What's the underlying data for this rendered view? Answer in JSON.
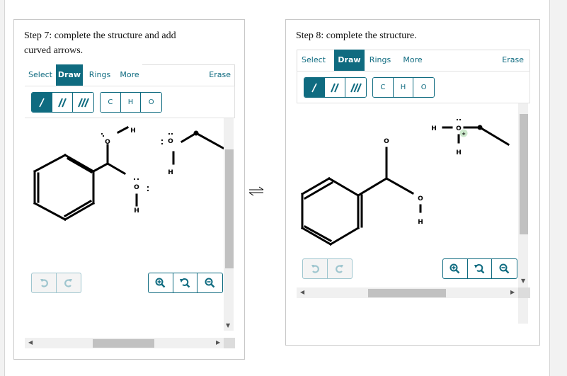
{
  "steps": [
    {
      "title_line1": "Step 7: complete the structure and add",
      "title_line2": "curved arrows.",
      "tabs": {
        "select": "Select",
        "draw": "Draw",
        "rings": "Rings",
        "more": "More",
        "erase": "Erase"
      },
      "active_tab": "Draw",
      "bond_tools": [
        {
          "name": "single-bond",
          "selected": true
        },
        {
          "name": "double-bond",
          "selected": false
        },
        {
          "name": "triple-bond",
          "selected": false
        }
      ],
      "atom_tools": [
        "C",
        "H",
        "O"
      ],
      "molecule_labels": {
        "o_top": "O",
        "h_top": "H",
        "o_mid": "O",
        "h_mid": "H",
        "o_eth": "O",
        "h_eth": "H"
      },
      "lone_pairs": {
        "two_dots": "¨",
        "colon": ":"
      }
    },
    {
      "title_line1": "Step 8: complete the structure.",
      "tabs": {
        "select": "Select",
        "draw": "Draw",
        "rings": "Rings",
        "more": "More",
        "erase": "Erase"
      },
      "active_tab": "Draw",
      "bond_tools": [
        {
          "name": "single-bond",
          "selected": true
        },
        {
          "name": "double-bond",
          "selected": false
        },
        {
          "name": "triple-bond",
          "selected": false
        }
      ],
      "atom_tools": [
        "C",
        "H",
        "O"
      ],
      "molecule_labels": {
        "o_top": "O",
        "o_mid": "O",
        "h_mid": "H",
        "h_left": "H",
        "o_cation": "O",
        "h_below": "H",
        "charge": "+"
      }
    }
  ],
  "equilibrium_symbol": "⇌",
  "colors": {
    "accent": "#0f6b80",
    "charge_bg": "#cce8cc"
  }
}
